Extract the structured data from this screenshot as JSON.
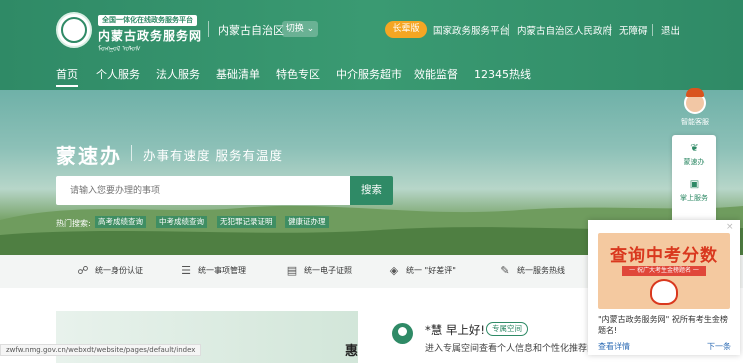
{
  "header": {
    "logo_tag": "全国一体化在线政务服务平台",
    "logo_title": "内蒙古政务服务网",
    "logo_mongolian": "ᠮᠣᠩᠭᠣᠯ ᠤᠯᠤᠰ",
    "region": "内蒙古自治区",
    "switch_label": "切换 ⌄",
    "elder_label": "长辈版",
    "links": [
      "国家政务服务平台",
      "内蒙古自治区人民政府",
      "无障碍",
      "退出"
    ]
  },
  "nav": {
    "items": [
      "首页",
      "个人服务",
      "法人服务",
      "基础清单",
      "特色专区",
      "中介服务超市",
      "效能监督",
      "12345热线"
    ]
  },
  "hero": {
    "brand": "蒙速办",
    "slogan": "办事有速度  服务有温度",
    "search_placeholder": "请输入您要办理的事项",
    "search_button": "搜索",
    "hot_label": "热门搜索:",
    "hot_tags": [
      "高考成绩查询",
      "中考成绩查询",
      "无犯罪记录证明",
      "健康证办理"
    ]
  },
  "sidebar": {
    "assistant_label": "智能客服",
    "items": [
      {
        "label": "蒙速办",
        "icon": "leaf-icon"
      },
      {
        "label": "掌上服务",
        "icon": "phone-icon"
      }
    ]
  },
  "services": {
    "items": [
      {
        "label": "统一身份认证",
        "icon": "users-icon"
      },
      {
        "label": "统一事项管理",
        "icon": "list-icon"
      },
      {
        "label": "统一电子证照",
        "icon": "id-card-icon"
      },
      {
        "label": "统一 \"好差评\"",
        "icon": "thumb-icon"
      },
      {
        "label": "统一服务热线",
        "icon": "edit-icon"
      }
    ]
  },
  "main": {
    "banner_char": "惠",
    "url": "zwfw.nmg.gov.cn/webxdt/website/pages/default/index",
    "greeting": "*慧 早上好!",
    "space_tag": "专属空间",
    "enter_text": "进入专属空间查看个人信息和个性化推荐内"
  },
  "popup": {
    "title": "查询中考分数",
    "ribbon": "一 祝广大考生金榜题名 一",
    "text": "\"内蒙古政务服务网\" 祝所有考生金榜题名!",
    "details": "查看详情",
    "next": "下一条",
    "close": "×"
  },
  "colors": {
    "primary": "#2f8a66",
    "accent_orange": "#f5a623",
    "popup_red": "#d9381e"
  }
}
